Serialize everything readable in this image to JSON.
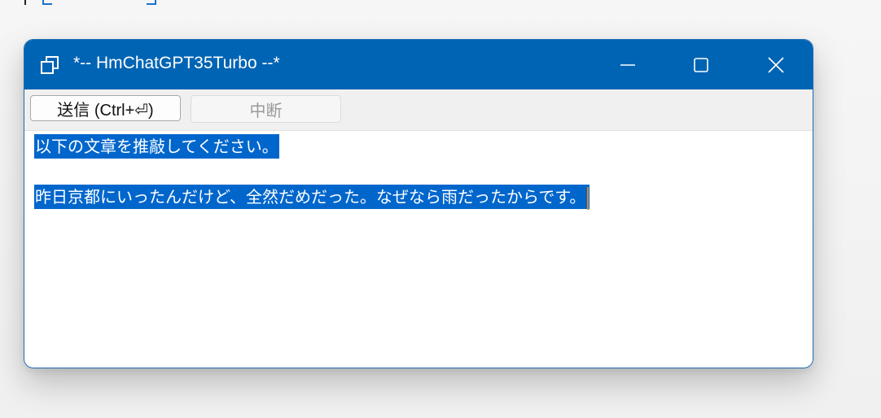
{
  "window": {
    "title": "*-- HmChatGPT35Turbo --*"
  },
  "toolbar": {
    "send_label": "送信 (Ctrl+⏎)",
    "stop_label": "中断"
  },
  "editor": {
    "lines": [
      "以下の文章を推敲してください。",
      "昨日京都にいったんだけど、全然だめだった。なぜなら雨だったからです。"
    ]
  },
  "colors": {
    "titlebar": "#0064b4",
    "selection": "#0066cc"
  }
}
